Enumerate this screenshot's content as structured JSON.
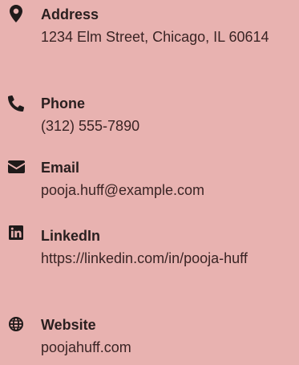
{
  "contacts": [
    {
      "icon": "map-marker-icon",
      "label": "Address",
      "value": "1234 Elm Street, Chicago, IL 60614"
    },
    {
      "icon": "phone-icon",
      "label": "Phone",
      "value": "(312) 555-7890"
    },
    {
      "icon": "envelope-icon",
      "label": "Email",
      "value": "pooja.huff@example.com"
    },
    {
      "icon": "linkedin-icon",
      "label": "LinkedIn",
      "value": "https://linkedin.com/in/pooja-huff"
    },
    {
      "icon": "globe-icon",
      "label": "Website",
      "value": "poojahuff.com"
    }
  ],
  "colors": {
    "background": "#e8b2b0",
    "text": "#2a1f1f",
    "icon": "#1f1a1a"
  }
}
